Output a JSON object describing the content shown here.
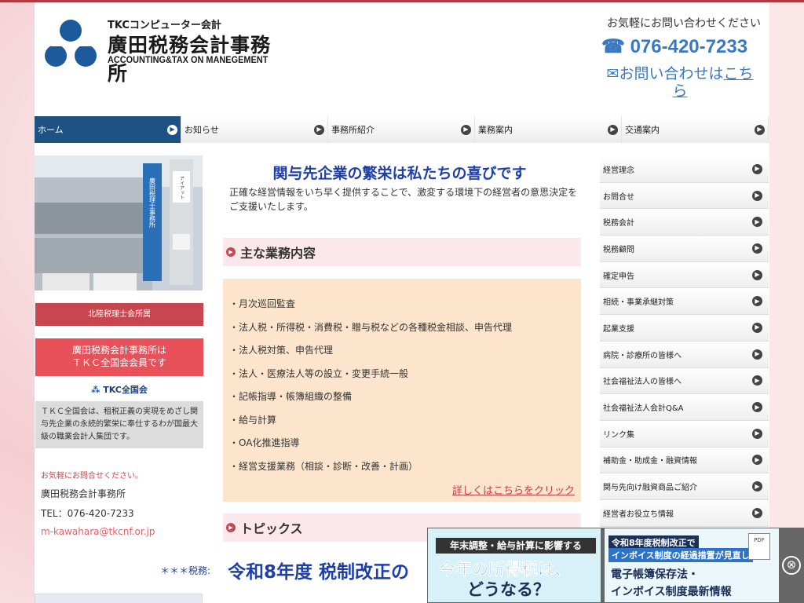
{
  "header": {
    "logo_small": "TKCコンピューター会計",
    "logo_name": "廣田税務会計事務所",
    "logo_en": "ACCOUNTING&TAX ON MANEGEMENT",
    "contact_lead": "お気軽にお問い合わせください",
    "tel_icon": "☎",
    "tel": "076-420-7233",
    "form_icon": "✉",
    "form_text": "お問い合わせは",
    "form_link": "こちら"
  },
  "nav": [
    {
      "label": "ホーム",
      "active": true
    },
    {
      "label": "お知らせ"
    },
    {
      "label": "事務所紹介"
    },
    {
      "label": "業務案内"
    },
    {
      "label": "交通案内"
    }
  ],
  "left": {
    "building_signs": [
      "廣田税理士事務所",
      "アイアット"
    ],
    "badge": "北陸税理士会所属",
    "tkc_member_line1": "廣田税務会計事務所は",
    "tkc_member_line2": "ＴＫＣ全国会会員です",
    "tkc_logo": "TKC全国会",
    "tkc_desc": "ＴＫＣ全国会は、租税正義の実現をめざし関与先企業の永続的繁栄に奉仕するわが国最大級の職業会計人集団です。",
    "inq_label": "お気軽にお問合せください。",
    "inq_name": "廣田税務会計事務所",
    "inq_tel": "TEL：076-420-7233",
    "inq_mail": "m-kawahara@tkcnf.or.jp",
    "tax_label": "＊＊＊税務:"
  },
  "main": {
    "title": "関与先企業の繁栄は私たちの喜びです",
    "lead": "正確な経営情報をいち早く提供することで、激変する環境下の経営者の意思決定をご支援いたします。",
    "section1": "主な業務内容",
    "items": [
      "・月次巡回監査",
      "・法人税・所得税・消費税・贈与税などの各種税金相談、申告代理",
      "・法人税対策、申告代理",
      "・法人・医療法人等の設立・変更手続一般",
      "・記帳指導・帳簿組織の整備",
      "・給与計算",
      "・OA化推進指導",
      "・経営支援業務（相談・診断・改善・計画）"
    ],
    "more": "詳しくはこちらをクリック",
    "section2": "トピックス",
    "topic_title": "令和8年度 税制改正の"
  },
  "right_nav": [
    "経営理念",
    "お問合せ",
    "税務会計",
    "税務顧問",
    "確定申告",
    "相続・事業承継対策",
    "起業支援",
    "病院・診療所の皆様へ",
    "社会福祉法人の皆様へ",
    "社会福祉法人会計Q&A",
    "リンク集",
    "補助金・助成金・融資情報",
    "関与先向け融資商品ご紹介",
    "経営者お役立ち情報"
  ],
  "banner": {
    "b1_top": "年末調整・給与計算に影響する",
    "b1_mid": "今年の所得税は、",
    "b1_bot": "どうなる？",
    "b2_a": "令和8年度税制改正で",
    "b2_b": "インボイス制度の経過措置が見直し",
    "b2_c": "電子帳簿保存法・",
    "b2_d": "インボイス制度最新情報",
    "pdf": "PDF",
    "close": "⊗"
  }
}
